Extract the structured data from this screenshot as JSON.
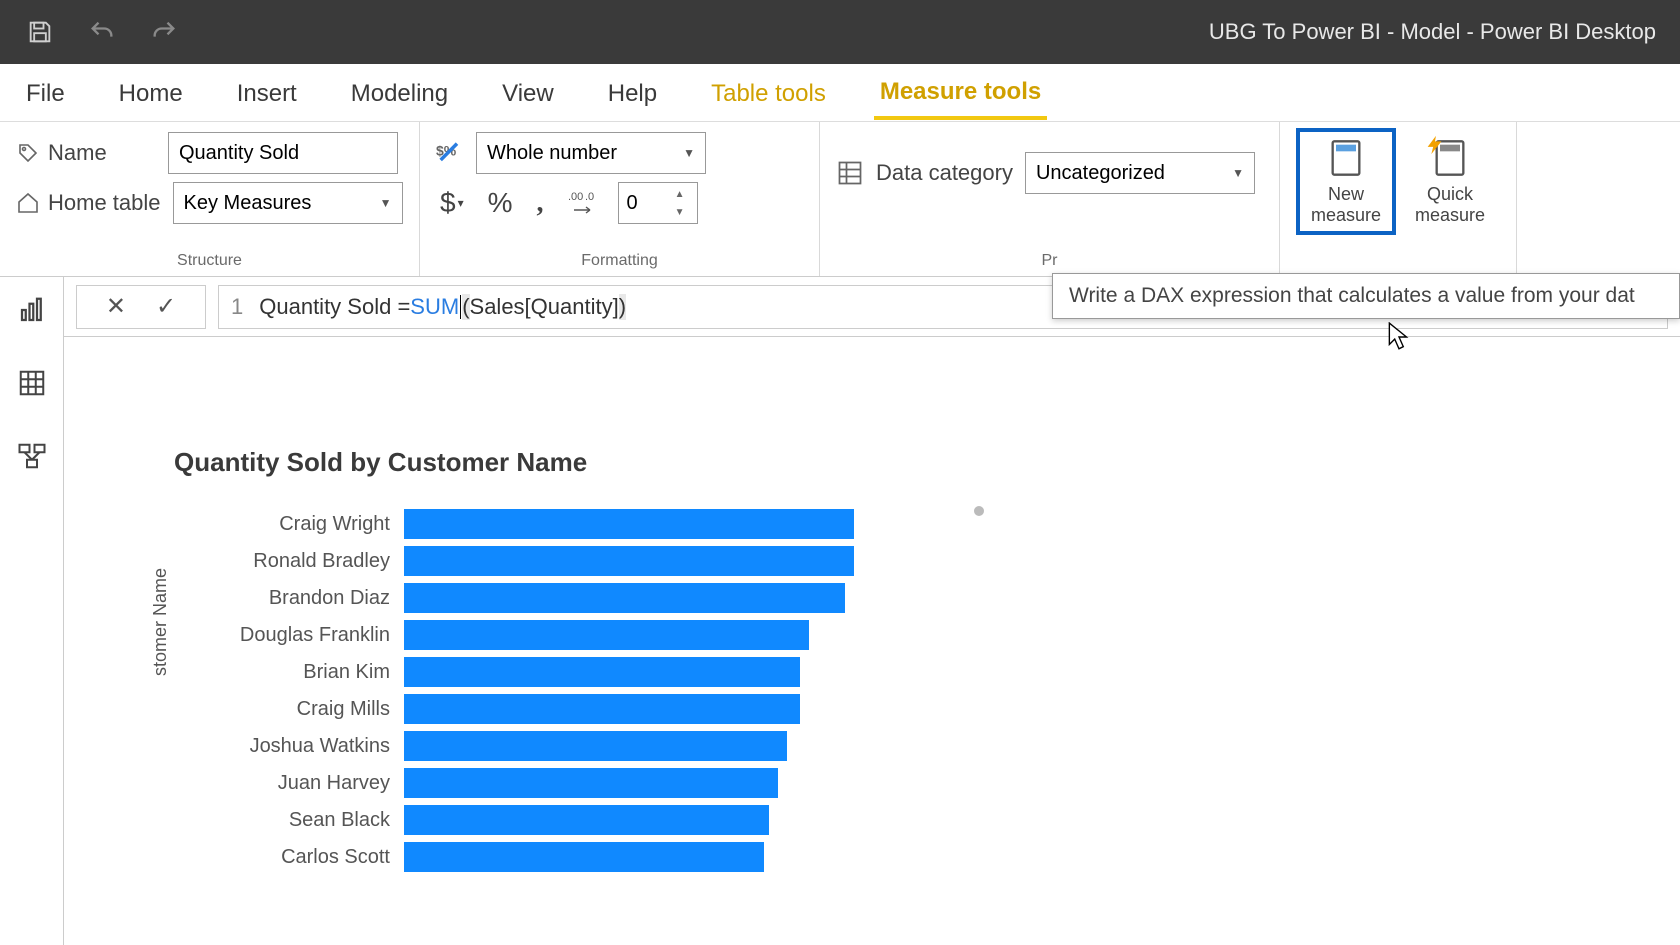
{
  "titlebar": {
    "title": "UBG To Power BI - Model - Power BI Desktop"
  },
  "tabs": {
    "file": "File",
    "home": "Home",
    "insert": "Insert",
    "modeling": "Modeling",
    "view": "View",
    "help": "Help",
    "table_tools": "Table tools",
    "measure_tools": "Measure tools"
  },
  "ribbon": {
    "name_label": "Name",
    "name_value": "Quantity Sold",
    "home_table_label": "Home table",
    "home_table_value": "Key Measures",
    "format_type": "Whole number",
    "decimal_places": "0",
    "data_category_label": "Data category",
    "data_category_value": "Uncategorized",
    "new_measure": "New measure",
    "quick_measure": "Quick measure",
    "group_structure": "Structure",
    "group_formatting": "Formatting",
    "group_properties": "Pr",
    "tooltip": "Write a DAX expression that calculates a value from your dat"
  },
  "formula": {
    "line_no": "1",
    "text_before_fn": "Quantity Sold = ",
    "fn": "SUM",
    "open": "(",
    "arg": " Sales[Quantity] ",
    "close": ")"
  },
  "chart_data": {
    "type": "bar",
    "title": "Quantity Sold by Customer Name",
    "ylabel": "stomer Name",
    "categories": [
      "Craig Wright",
      "Ronald Bradley",
      "Brandon Diaz",
      "Douglas Franklin",
      "Brian Kim",
      "Craig Mills",
      "Joshua Watkins",
      "Juan Harvey",
      "Sean Black",
      "Carlos Scott"
    ],
    "values": [
      100,
      100,
      98,
      90,
      88,
      88,
      85,
      83,
      81,
      80
    ],
    "max": 100
  }
}
